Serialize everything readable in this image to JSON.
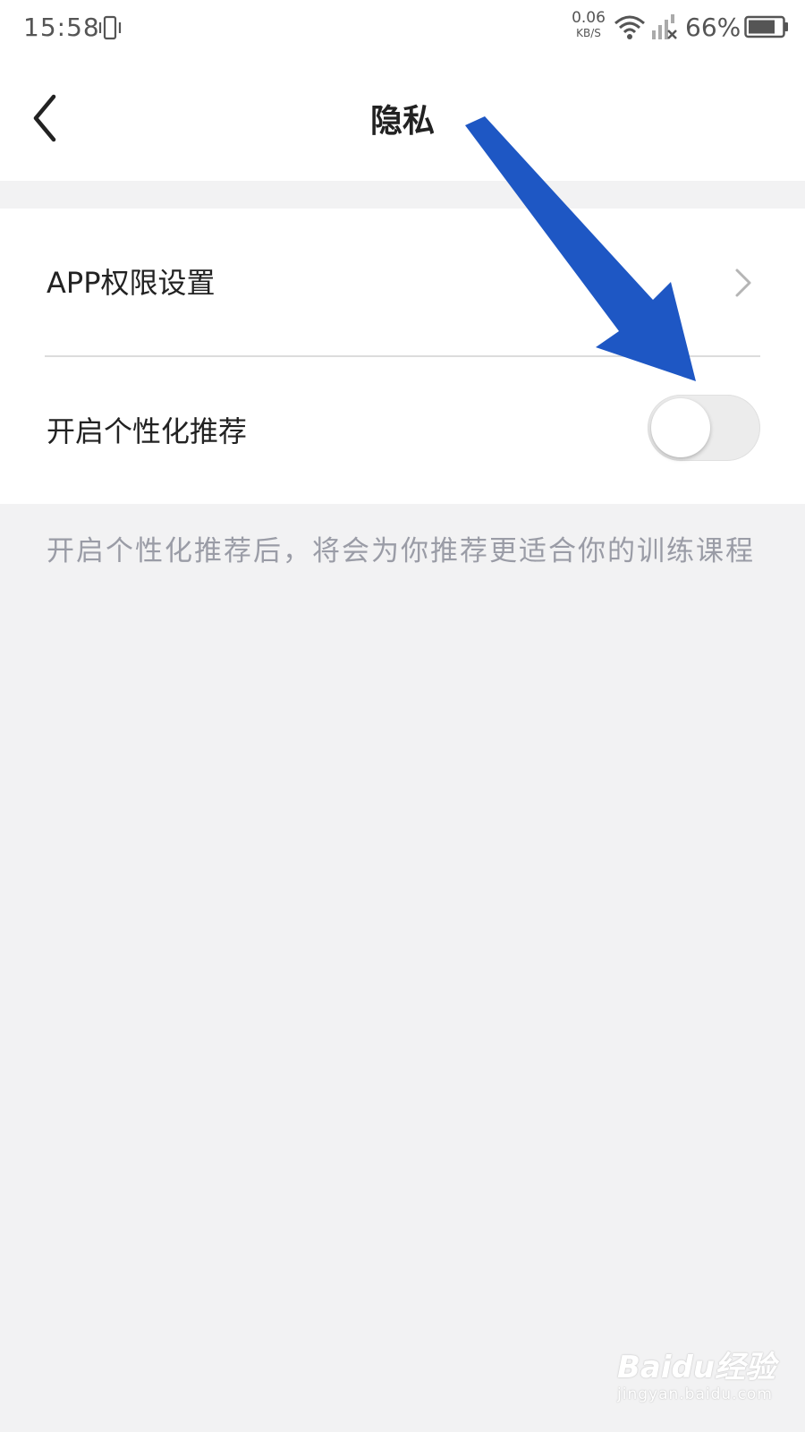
{
  "status_bar": {
    "time": "15:58",
    "net_speed_value": "0.06",
    "net_speed_unit": "KB/S",
    "battery_percent": "66%",
    "icons": [
      "vibrate-icon",
      "wifi-icon",
      "signal-icon",
      "battery-icon"
    ]
  },
  "header": {
    "title": "隐私",
    "back_icon": "back-arrow-icon"
  },
  "settings": {
    "items": [
      {
        "label": "APP权限设置",
        "type": "link",
        "icon": "chevron-right-icon"
      },
      {
        "label": "开启个性化推荐",
        "type": "toggle",
        "enabled": false
      }
    ]
  },
  "description": "开启个性化推荐后，将会为你推荐更适合你的训练课程",
  "annotation": {
    "type": "arrow",
    "color": "#1e57c4"
  },
  "watermark": {
    "brand": "Baidu经验",
    "url": "jingyan.baidu.com"
  },
  "colors": {
    "background": "#f2f2f3",
    "surface": "#ffffff",
    "text_primary": "#222222",
    "text_secondary": "#9a9ca6",
    "toggle_off": "#ececec"
  }
}
